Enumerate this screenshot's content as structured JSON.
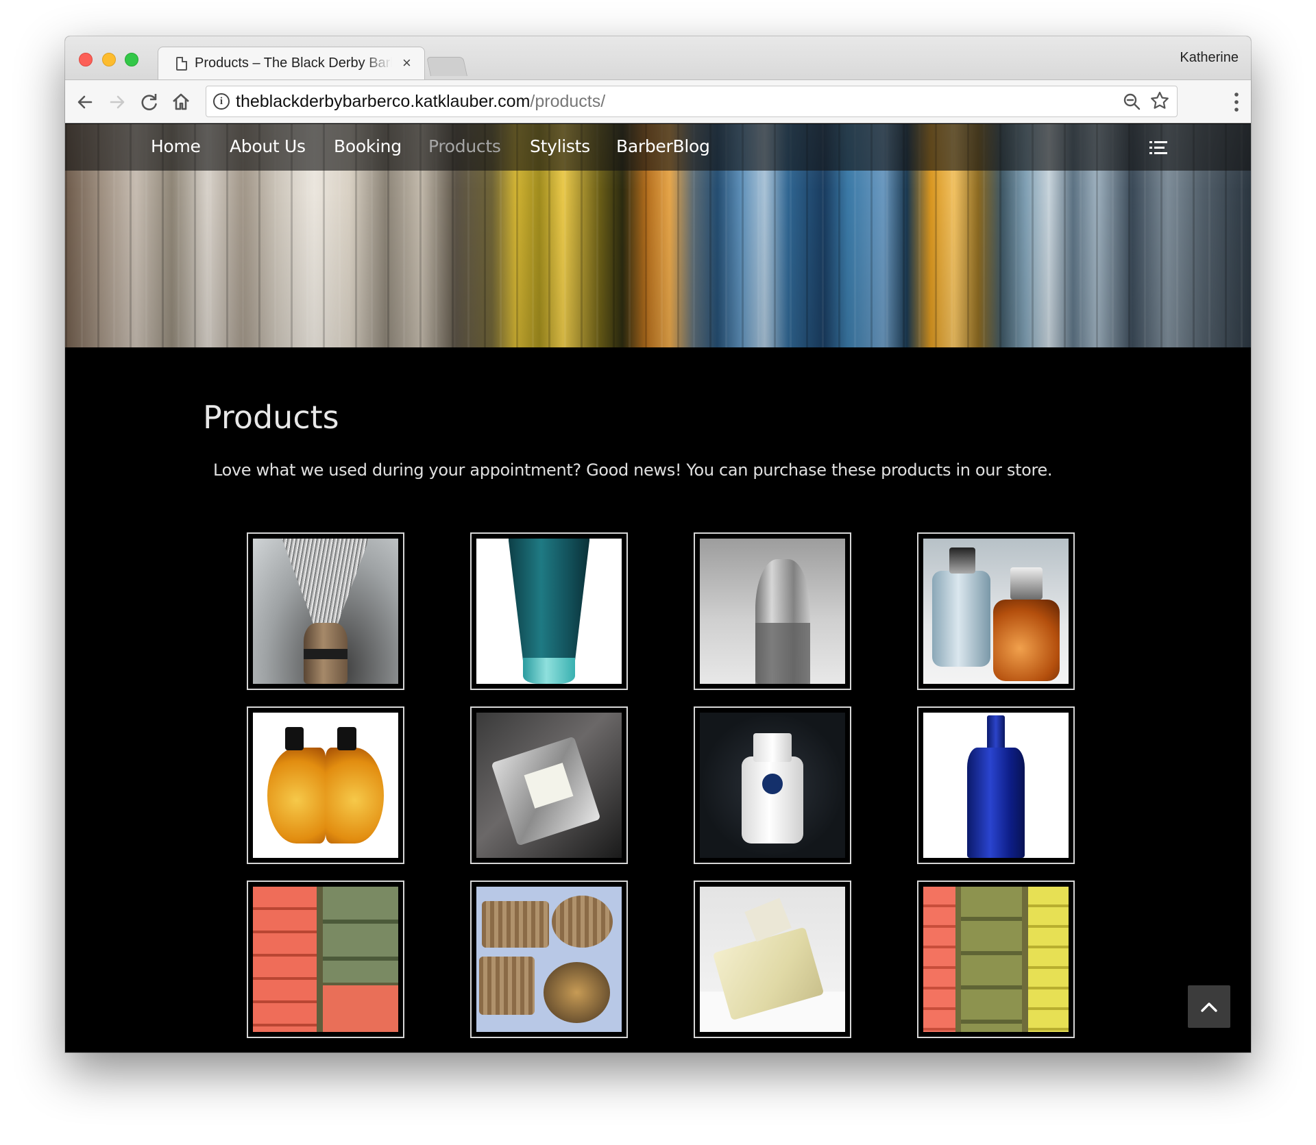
{
  "browser": {
    "tab_title": "Products – The Black Derby Barber Co",
    "tab_close": "×",
    "profile_name": "Katherine",
    "url_host": "theblackderbybarberco.katklauber.com",
    "url_path": "/products/",
    "icons": [
      "back-icon",
      "forward-icon",
      "reload-icon",
      "home-icon",
      "info-icon",
      "zoom-icon",
      "star-icon",
      "menu-dots-icon"
    ]
  },
  "nav": {
    "items": [
      {
        "label": "Home"
      },
      {
        "label": "About Us"
      },
      {
        "label": "Booking"
      },
      {
        "label": "Products",
        "active": true
      },
      {
        "label": "Stylists"
      },
      {
        "label": "BarberBlog"
      }
    ],
    "active_color": "#a6a6a6"
  },
  "page": {
    "title": "Products",
    "intro": "Love what we used during your appointment? Good news! You can purchase these products in our store."
  },
  "products": [
    {
      "image": "shaving-brush"
    },
    {
      "image": "teal-tube"
    },
    {
      "image": "clear-bottle"
    },
    {
      "image": "perfume-bottles"
    },
    {
      "image": "amber-oil-bottle"
    },
    {
      "image": "jo-malone-cologne"
    },
    {
      "image": "nivea-balm"
    },
    {
      "image": "blue-glass-bottle"
    },
    {
      "image": "marseille-soaps"
    },
    {
      "image": "handmade-soaps"
    },
    {
      "image": "wrapped-soap-bar"
    },
    {
      "image": "colorful-soap-bars"
    }
  ]
}
